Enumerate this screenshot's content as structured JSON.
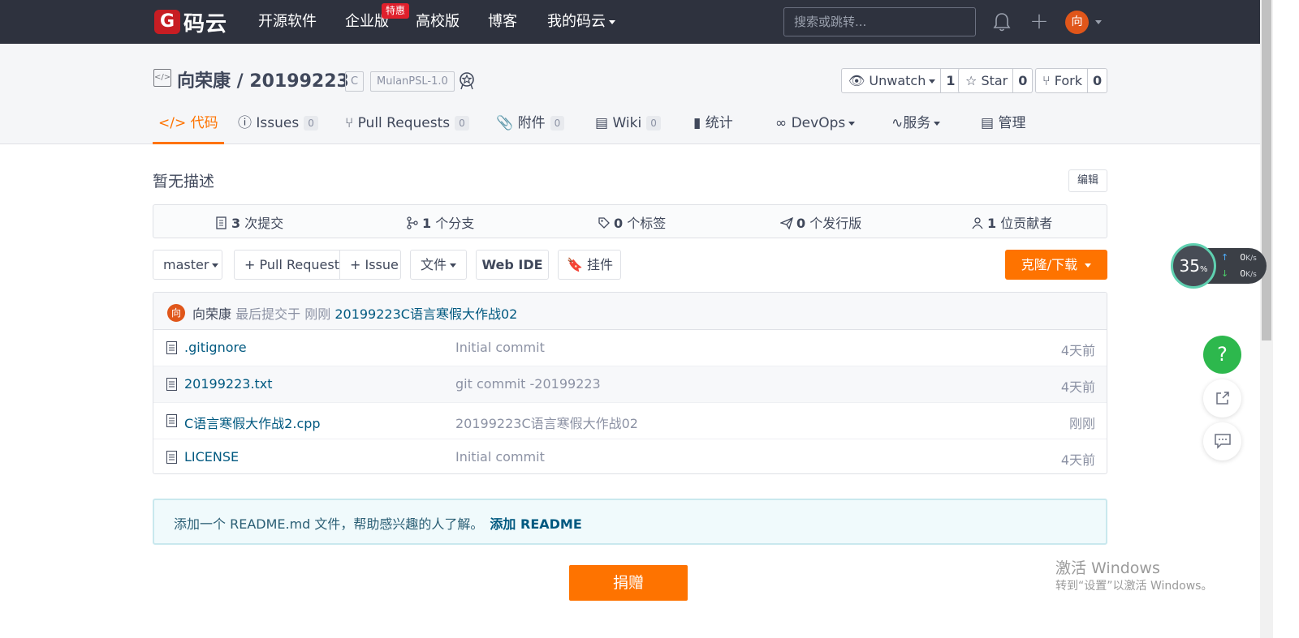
{
  "navbar": {
    "logo_mark": "G",
    "logo_text": "码云",
    "items": [
      {
        "label": "开源软件"
      },
      {
        "label": "企业版"
      },
      {
        "label": "高校版"
      },
      {
        "label": "博客"
      },
      {
        "label": "我的码云"
      }
    ],
    "enterprise_badge": "特惠",
    "search_placeholder": "搜索或跳转...",
    "avatar_initial": "向",
    "bell_icon": "bell-icon",
    "plus_icon": "plus-icon"
  },
  "repo": {
    "title": "向荣康 / 20199223",
    "language_tag": "C",
    "license_tag": "MulanPSL-1.0",
    "watch": {
      "label": "Unwatch",
      "count": "1"
    },
    "star": {
      "label": "Star",
      "count": "0"
    },
    "fork": {
      "label": "Fork",
      "count": "0"
    }
  },
  "tabs": [
    {
      "icon": "</>",
      "label": "代码",
      "count": null
    },
    {
      "icon": "ⓘ",
      "label": "Issues",
      "count": "0"
    },
    {
      "icon": "⑂",
      "label": "Pull Requests",
      "count": "0"
    },
    {
      "icon": "📎",
      "label": "附件",
      "count": "0"
    },
    {
      "icon": "▤",
      "label": "Wiki",
      "count": "0"
    },
    {
      "icon": "▮",
      "label": "统计",
      "count": null
    },
    {
      "icon": "∞",
      "label": "DevOps",
      "count": null
    },
    {
      "icon": "∿",
      "label": "服务",
      "count": null
    },
    {
      "icon": "▤",
      "label": "管理",
      "count": null
    }
  ],
  "main": {
    "description": "暂无描述",
    "edit_label": "编辑",
    "stats": [
      {
        "count": "3",
        "label": "次提交"
      },
      {
        "count": "1",
        "label": "个分支"
      },
      {
        "count": "0",
        "label": "个标签"
      },
      {
        "count": "0",
        "label": "个发行版"
      },
      {
        "count": "1",
        "label": "位贡献者"
      }
    ],
    "toolbar": {
      "branch": "master",
      "pull_request": "+ Pull Request",
      "issue": "+ Issue",
      "file": "文件",
      "web_ide": "Web IDE",
      "pin": "挂件",
      "clone": "克隆/下载"
    },
    "last_commit": {
      "avatar_initial": "向",
      "author": "向荣康",
      "prefix": "最后提交于",
      "time": "刚刚",
      "message": "20199223C语言寒假大作战02"
    },
    "files": [
      {
        "name": ".gitignore",
        "message": "Initial commit",
        "time": "4天前"
      },
      {
        "name": "20199223.txt",
        "message": "git commit -20199223",
        "time": "4天前"
      },
      {
        "name": "C语言寒假大作战2.cpp",
        "message": "20199223C语言寒假大作战02",
        "time": "刚刚"
      },
      {
        "name": "LICENSE",
        "message": "Initial commit",
        "time": "4天前"
      }
    ],
    "readme_notice": "添加一个 README.md 文件，帮助感兴趣的人了解。",
    "readme_link": "添加 README",
    "donate_label": "捐赠"
  },
  "net_widget": {
    "percent": "35",
    "percent_sign": "%",
    "up_value": "0",
    "down_value": "0",
    "unit": "K/s"
  },
  "floating": {
    "help": "?"
  },
  "watermark": {
    "title": "激活 Windows",
    "subtitle": "转到“设置”以激活 Windows。"
  }
}
